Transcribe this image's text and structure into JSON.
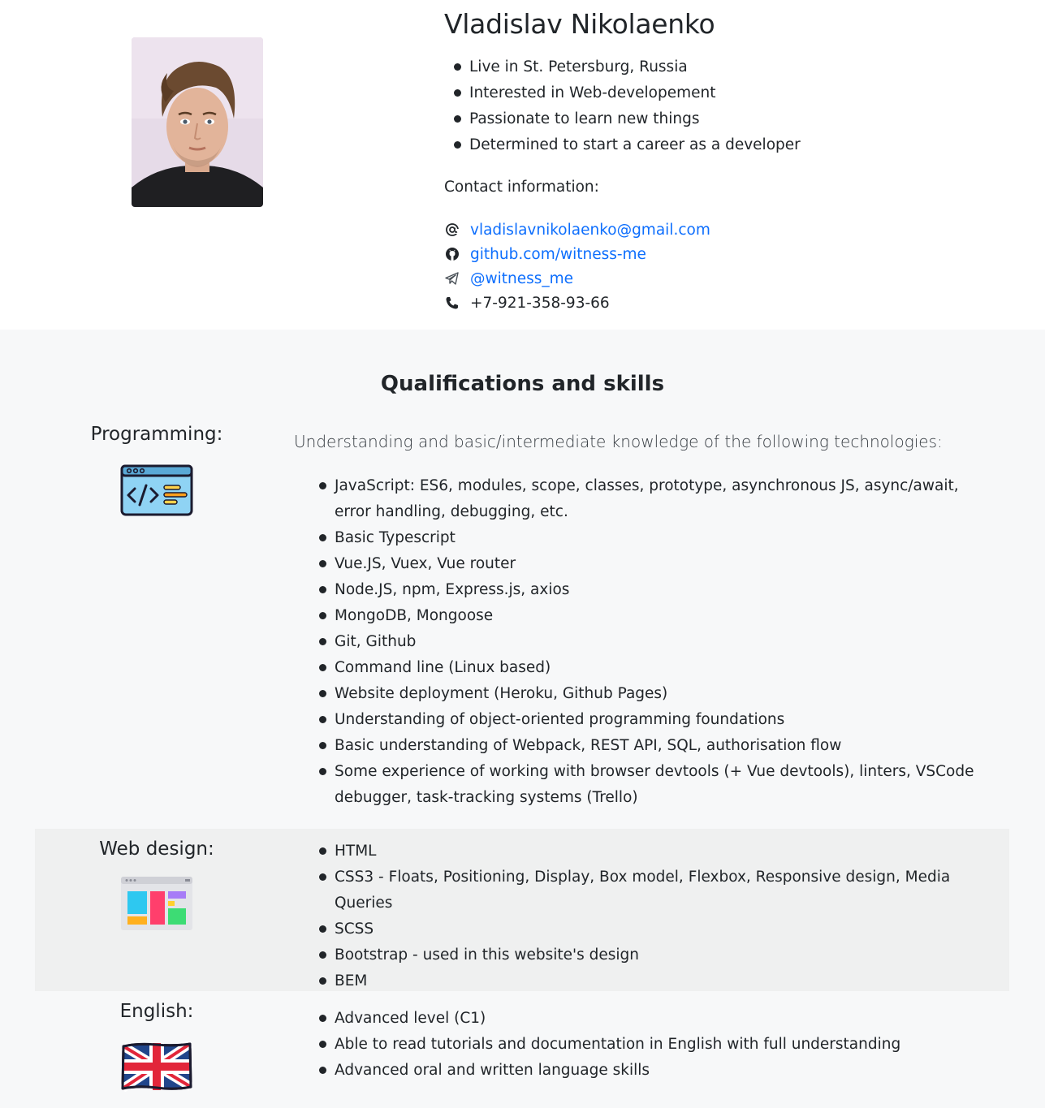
{
  "profile": {
    "name": "Vladislav Nikolaenko",
    "bio": [
      "Live in St. Petersburg, Russia",
      "Interested in Web-developement",
      "Passionate to learn new things",
      "Determined to start a career as a developer"
    ],
    "contact_title": "Contact information:",
    "contacts": {
      "email": "vladislavnikolaenko@gmail.com",
      "github": "github.com/witness-me",
      "telegram": "@witness_me",
      "phone": "+7-921-358-93-66"
    }
  },
  "skills": {
    "title": "Qualifications and skills",
    "programming": {
      "label": "Programming:",
      "intro": "Understanding and basic/intermediate knowledge of the following technologies:",
      "items": [
        "JavaScript: ES6, modules, scope, classes, prototype, asynchronous JS, async/await, error handling, debugging, etc.",
        "Basic Typescript",
        "Vue.JS, Vuex, Vue router",
        "Node.JS, npm, Express.js, axios",
        "MongoDB, Mongoose",
        "Git, Github",
        "Command line (Linux based)",
        "Website deployment (Heroku, Github Pages)",
        "Understanding of object-oriented programming foundations",
        "Basic understanding of Webpack, REST API, SQL, authorisation flow",
        "Some experience of working with browser devtools (+ Vue devtools), linters, VSCode debugger, task-tracking systems (Trello)"
      ]
    },
    "web_design": {
      "label": "Web design:",
      "items": [
        "HTML",
        "CSS3 - Floats, Positioning, Display, Box model, Flexbox, Responsive design, Media Queries",
        "SCSS",
        "Bootstrap - used in this website's design",
        "BEM"
      ]
    },
    "english": {
      "label": "English:",
      "items": [
        "Advanced level (C1)",
        "Able to read tutorials and documentation in English with full understanding",
        "Advanced oral and written language skills"
      ]
    }
  },
  "colors": {
    "link": "#0d6efd",
    "text": "#212529",
    "section_bg": "#f7f8f9",
    "web_block_bg": "#eff0f0"
  }
}
